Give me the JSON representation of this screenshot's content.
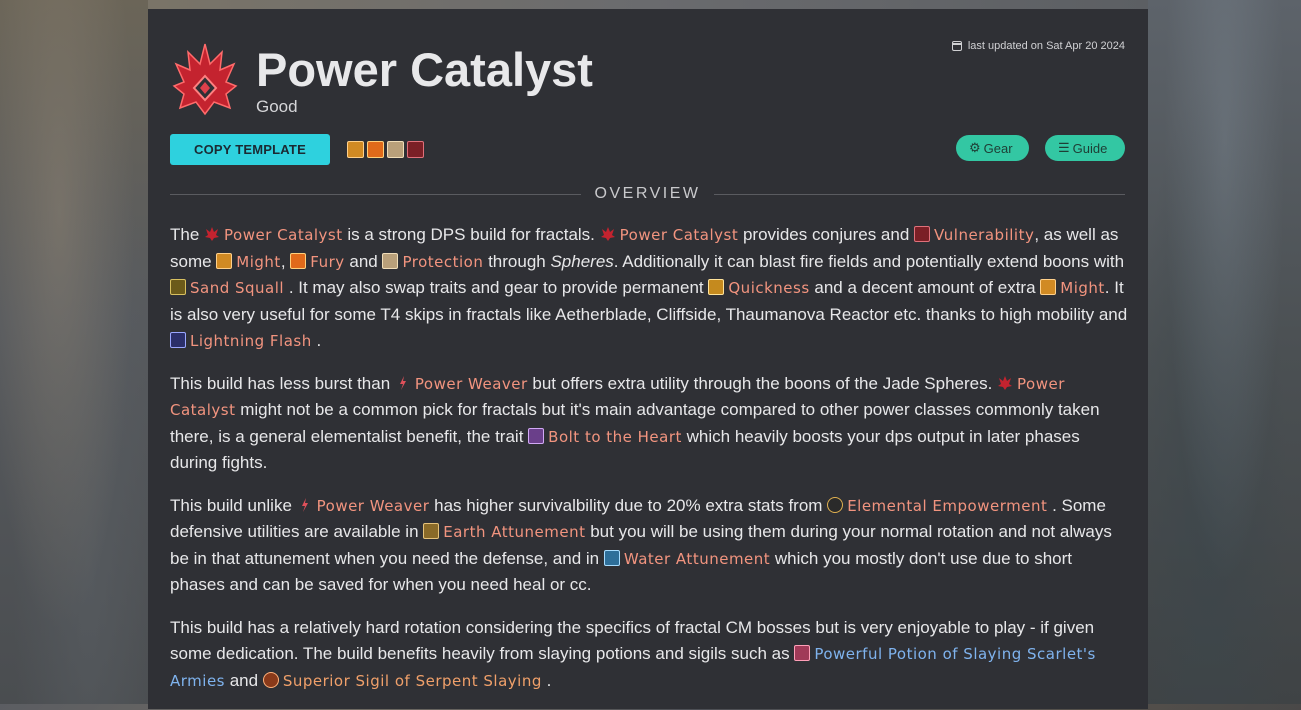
{
  "build": {
    "title": "Power Catalyst",
    "rating": "Good",
    "last_updated": "last updated on Sat Apr 20 2024",
    "copy_label": "COPY TEMPLATE",
    "boons": [
      "might-icon",
      "fury-icon",
      "protection-icon",
      "vulnerability-icon"
    ]
  },
  "nav": {
    "gear_label": "Gear",
    "guide_label": "Guide"
  },
  "section": {
    "overview": "OVERVIEW"
  },
  "colors": {
    "accent_cyan": "#2ed1de",
    "pill_green": "#33c7a3",
    "link_red": "#f2947f",
    "link_blue": "#7fb3ee",
    "panel_bg": "#2f3035"
  },
  "p1": {
    "t1": "The ",
    "l1": "Power Catalyst",
    "t2": " is a strong DPS build for fractals. ",
    "l2": "Power Catalyst",
    "t3": " provides conjures and ",
    "l3": "Vulnerability",
    "t4": ", as well as some ",
    "l4": "Might",
    "t5": ", ",
    "l5": "Fury",
    "t6": " and ",
    "l6": "Protection",
    "t7": " through ",
    "em1": "Spheres",
    "t8": ". Additionally it can blast fire fields and potentially extend boons with ",
    "l7": "Sand Squall",
    "t9": " . It may also swap traits and gear to provide permanent ",
    "l8": "Quickness",
    "t10": " and a decent amount of extra ",
    "l9": "Might",
    "t11": ". It is also very useful for some T4 skips in fractals like Aetherblade, Cliffside, Thaumanova Reactor etc. thanks to high mobility and ",
    "l10": "Lightning Flash",
    "t12": " ."
  },
  "p2": {
    "t1": "This build has less burst than ",
    "l1": "Power Weaver",
    "t2": " but offers extra utility through the boons of the Jade Spheres. ",
    "l2": "Power Catalyst",
    "t3": " might not be a common pick for fractals but it's main advantage compared to other power classes commonly taken there, is a general elementalist benefit, the trait ",
    "l3": "Bolt to the Heart",
    "t4": " which heavily boosts your dps output in later phases during fights."
  },
  "p3": {
    "t1": "This build unlike ",
    "l1": "Power Weaver",
    "t2": " has higher survivalbility due to 20% extra stats from ",
    "l2": "Elemental Empowerment",
    "t3": " . Some defensive utilities are available in ",
    "l3": "Earth Attunement",
    "t4": " but you will be using them during your normal rotation and not always be in that attunement when you need the defense, and in ",
    "l4": "Water Attunement",
    "t5": " which you mostly don't use due to short phases and can be saved for when you need heal or cc."
  },
  "p4": {
    "t1": "This build has a relatively hard rotation considering the specifics of fractal CM bosses but is very enjoyable to play - if given some dedication. The build benefits heavily from slaying potions and sigils such as ",
    "l1": "Powerful Potion of Slaying Scarlet's Armies",
    "t2": " and ",
    "l2": "Superior Sigil of Serpent Slaying",
    "t3": " ."
  }
}
